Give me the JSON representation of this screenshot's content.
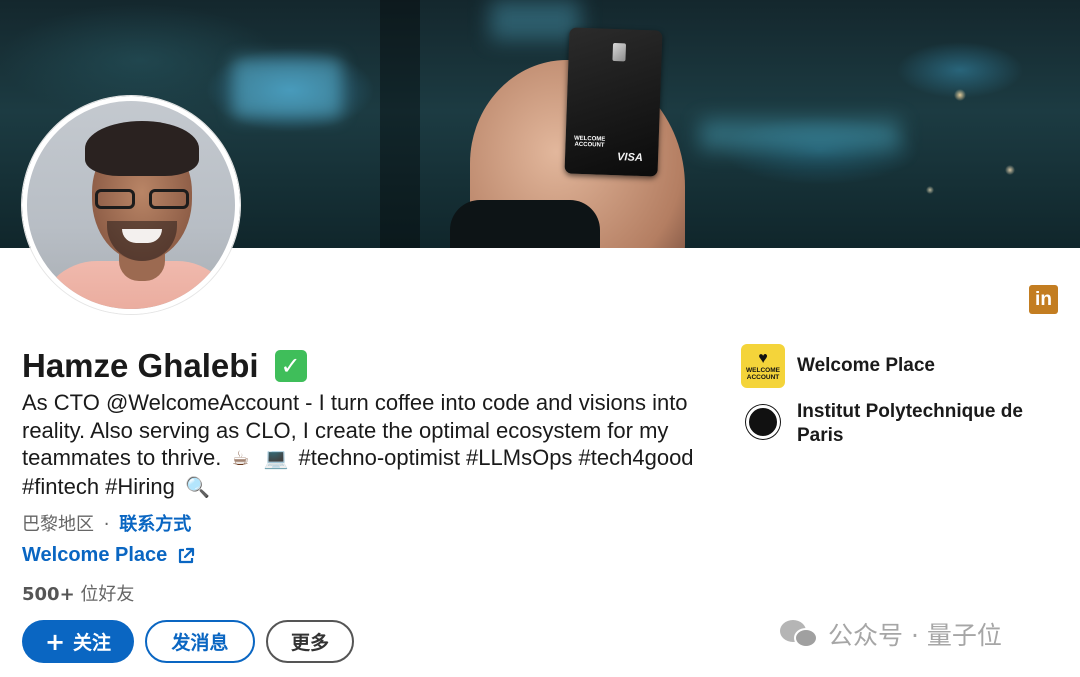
{
  "profile": {
    "name": "Hamze Ghalebi",
    "verified_icon": "checkmark-badge-icon",
    "headline_part1": "As CTO @WelcomeAccount - I turn coffee into code and visions into reality. Also serving as CLO, I create the optimal ecosystem for my teammates to thrive.",
    "emoji_coffee": "☕",
    "emoji_laptop": "💻",
    "headline_part2": "#techno-optimist #LLMsOps #tech4good #fintech #Hiring",
    "emoji_magnifier": "🔍",
    "location": "巴黎地区",
    "separator": "·",
    "contact_link": "联系方式",
    "company_link": "Welcome Place",
    "connections_count": "500+",
    "connections_label": "位好友"
  },
  "actions": {
    "follow_plus": "+",
    "follow_label": "关注",
    "message_label": "发消息",
    "more_label": "更多"
  },
  "card": {
    "brand_line1": "WELCOME",
    "brand_line2": "ACCOUNT",
    "network": "VISA"
  },
  "linkedin_badge": "in",
  "experience": [
    {
      "name": "Welcome Place",
      "logo_line1": "WELCOME",
      "logo_line2": "ACCOUNT"
    },
    {
      "name": "Institut Polytechnique de Paris"
    }
  ],
  "watermark": {
    "text": "公众号 · 量子位"
  },
  "colors": {
    "accent": "#0a66c2",
    "verified": "#3fbe5a",
    "linkedin_badge": "#c37d21",
    "welcome_logo": "#f4d43a"
  }
}
